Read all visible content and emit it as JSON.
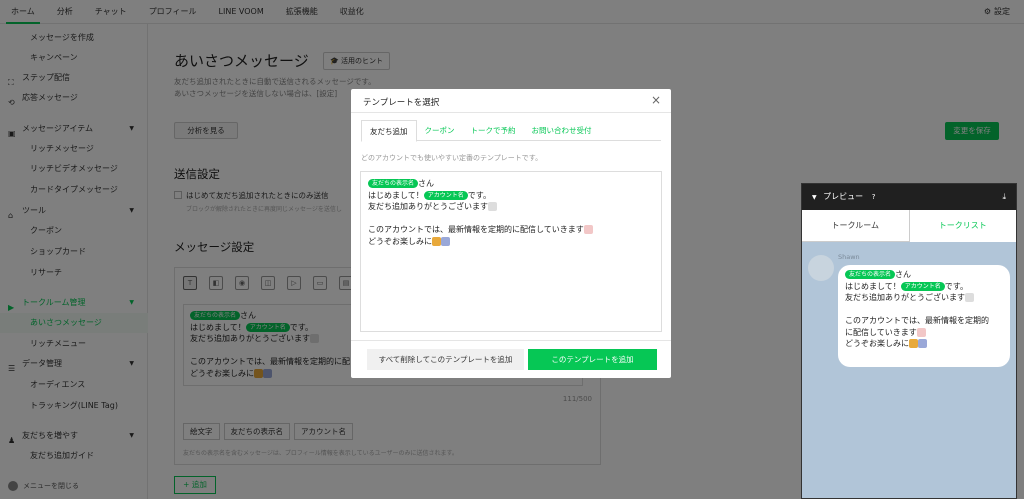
{
  "topnav": {
    "tabs": [
      "ホーム",
      "分析",
      "チャット",
      "プロフィール",
      "LINE VOOM",
      "拡張機能",
      "収益化"
    ],
    "settings": "設定"
  },
  "sidebar": {
    "items": [
      {
        "label": "メッセージを作成"
      },
      {
        "label": "キャンペーン"
      },
      {
        "label": "ステップ配信"
      },
      {
        "label": "応答メッセージ"
      },
      {
        "label": "メッセージアイテム"
      },
      {
        "label": "リッチメッセージ"
      },
      {
        "label": "リッチビデオメッセージ"
      },
      {
        "label": "カードタイプメッセージ"
      },
      {
        "label": "ツール"
      },
      {
        "label": "クーポン"
      },
      {
        "label": "ショップカード"
      },
      {
        "label": "リサーチ"
      },
      {
        "label": "トークルーム管理"
      },
      {
        "label": "あいさつメッセージ"
      },
      {
        "label": "リッチメニュー"
      },
      {
        "label": "データ管理"
      },
      {
        "label": "オーディエンス"
      },
      {
        "label": "トラッキング(LINE Tag)"
      },
      {
        "label": "友だちを増やす"
      },
      {
        "label": "友だち追加ガイド"
      }
    ],
    "close_label": "メニューを閉じる"
  },
  "main": {
    "title": "あいさつメッセージ",
    "hint_button": "活用のヒント",
    "desc1": "友だち追加されたときに自動で送信されるメッセージです。",
    "desc2": "あいさつメッセージを送信しない場合は、[設定]",
    "analyze_button": "分析を見る",
    "save_button": "変更を保存",
    "send_settings_title": "送信設定",
    "checkbox_label": "はじめて友だち追加されたときにのみ送信",
    "checkbox_note": "ブロックが解除されたときに再度同じメッセージを送信し",
    "message_settings_title": "メッセージ設定",
    "counter": "111/500",
    "insert_buttons": [
      "絵文字",
      "友だちの表示名",
      "アカウント名"
    ],
    "insert_note": "友だちの表示名を含むメッセージは、プロフィール情報を表示しているユーザーのみに送信されます。",
    "add_button": "+ 追加"
  },
  "message": {
    "name_tag": "友だちの表示名",
    "san": "さん",
    "line2_pre": "はじめまして！",
    "account_tag": "アカウント名",
    "line2_post": "です。",
    "line3": "友だち追加ありがとうございます",
    "line4": "このアカウントでは、最新情報を定期的に配信していきます",
    "line5": "どうぞお楽しみに",
    "line4_short": "このアカウントでは、最新情報を定期的に配"
  },
  "modal": {
    "title": "テンプレートを選択",
    "close": "×",
    "tabs": [
      "友だち追加",
      "クーポン",
      "トークで予約",
      "お問い合わせ受付"
    ],
    "desc": "どのアカウントでも使いやすい定番のテンプレートです。",
    "replace_button": "すべて削除してこのテンプレートを追加",
    "add_button": "このテンプレートを追加"
  },
  "preview": {
    "title": "プレビュー",
    "tabs": [
      "トークルーム",
      "トークリスト"
    ],
    "sender": "Shawn",
    "bubble_line4a": "このアカウントでは、最新情報を定期的",
    "bubble_line4b": "に配信していきます"
  },
  "colors": {
    "brand_green": "#06c755",
    "preview_bg": "#b1c5d8"
  }
}
